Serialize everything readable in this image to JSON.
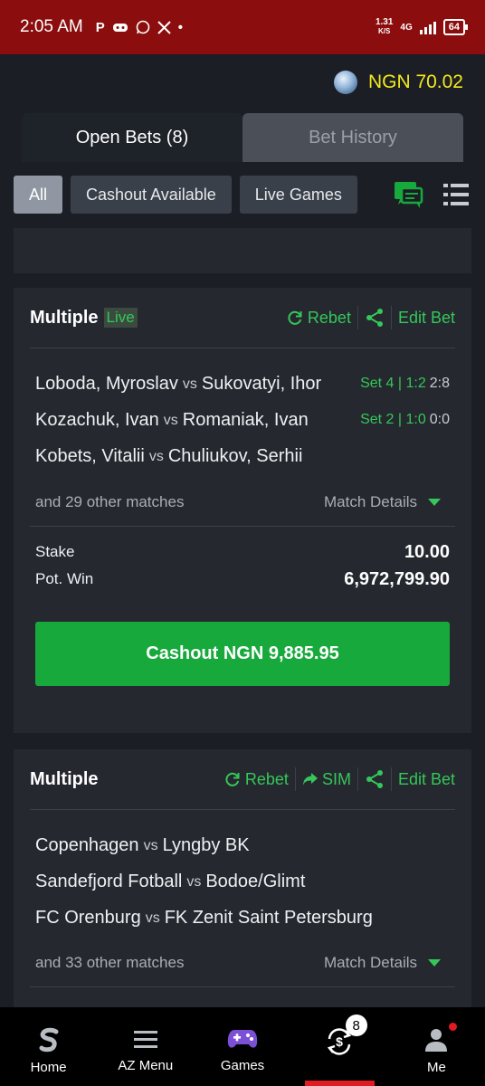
{
  "status_bar": {
    "time": "2:05 AM",
    "speed_value": "1.31",
    "speed_unit": "K/S",
    "network": "4G",
    "battery": "64"
  },
  "header": {
    "balance": "NGN 70.02"
  },
  "tabs": [
    {
      "label": "Open Bets (8)",
      "active": true
    },
    {
      "label": "Bet History",
      "active": false
    }
  ],
  "filters": [
    {
      "label": "All",
      "active": true
    },
    {
      "label": "Cashout Available",
      "active": false
    },
    {
      "label": "Live Games",
      "active": false
    }
  ],
  "bets": [
    {
      "title": "Multiple",
      "live_badge": "Live",
      "actions": {
        "rebet": "Rebet",
        "edit": "Edit Bet"
      },
      "matches": [
        {
          "home": "Loboda, Myroslav",
          "vs": "vs",
          "away": "Sukovatyi, Ihor",
          "live_info": "Set 4 | 1:2",
          "score": "2:8"
        },
        {
          "home": "Kozachuk, Ivan",
          "vs": "vs",
          "away": "Romaniak, Ivan",
          "live_info": "Set 2 | 1:0",
          "score": "0:0"
        },
        {
          "home": "Kobets, Vitalii",
          "vs": "vs",
          "away": "Chuliukov, Serhii"
        }
      ],
      "other_matches": "and 29 other matches",
      "match_details": "Match Details",
      "stake_label": "Stake",
      "stake": "10.00",
      "potwin_label": "Pot. Win",
      "potwin": "6,972,799.90",
      "cashout": "Cashout NGN 9,885.95"
    },
    {
      "title": "Multiple",
      "actions": {
        "rebet": "Rebet",
        "sim": "SIM",
        "edit": "Edit Bet"
      },
      "matches": [
        {
          "home": "Copenhagen",
          "vs": "vs",
          "away": "Lyngby BK"
        },
        {
          "home": "Sandefjord Fotball",
          "vs": "vs",
          "away": "Bodoe/Glimt"
        },
        {
          "home": "FC Orenburg",
          "vs": "vs",
          "away": "FK Zenit Saint Petersburg"
        }
      ],
      "other_matches": "and 33 other matches",
      "match_details": "Match Details"
    }
  ],
  "bottom_nav": [
    {
      "label": "Home",
      "icon": "sporty-logo-icon"
    },
    {
      "label": "AZ Menu",
      "icon": "hamburger-menu-icon"
    },
    {
      "label": "Games",
      "icon": "gamepad-icon"
    },
    {
      "label": "",
      "icon": "cashout-coin-icon",
      "badge": "8"
    },
    {
      "label": "Me",
      "icon": "user-icon"
    }
  ],
  "colors": {
    "accent_green": "#35c759",
    "cashout_green": "#17a93c",
    "balance_yellow": "#f4e81e",
    "status_red": "#8b0d0d"
  }
}
